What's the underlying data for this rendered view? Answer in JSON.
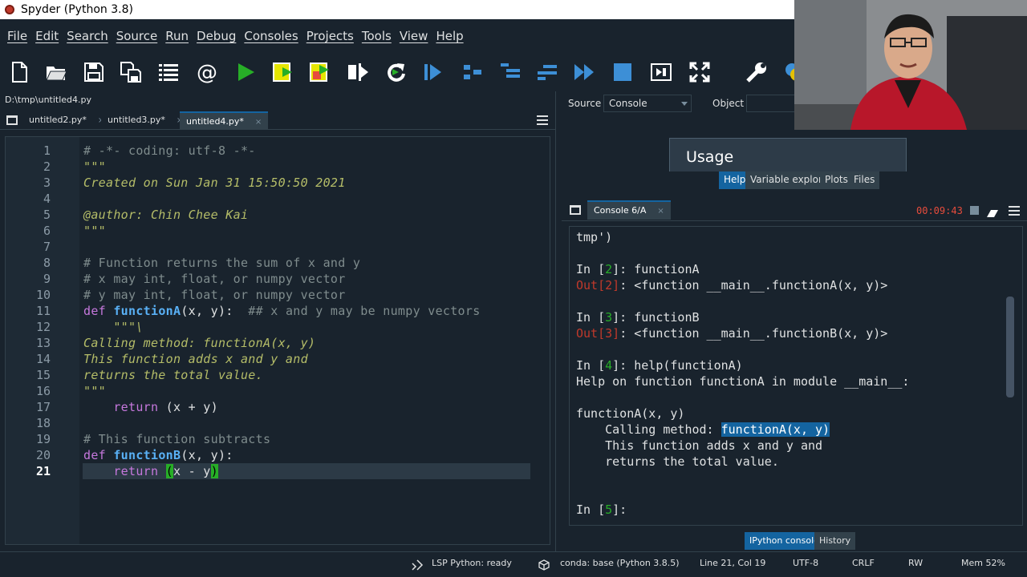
{
  "window": {
    "title": "Spyder (Python 3.8)"
  },
  "menu": [
    "File",
    "Edit",
    "Search",
    "Source",
    "Run",
    "Debug",
    "Consoles",
    "Projects",
    "Tools",
    "View",
    "Help"
  ],
  "toolbar_icons": [
    "new-file",
    "open-file",
    "save",
    "save-all",
    "outline",
    "email-at",
    "run",
    "run-cell",
    "run-cell-advance",
    "run-selection",
    "re-run",
    "debug",
    "debug-step",
    "debug-step-into",
    "debug-step-return",
    "debug-continue",
    "stop",
    "maximize",
    "fullscreen",
    "preferences",
    "python-path"
  ],
  "editor": {
    "path": "D:\\tmp\\untitled4.py",
    "tabs": [
      {
        "label": "untitled2.py*"
      },
      {
        "label": "untitled3.py*"
      },
      {
        "label": "untitled4.py*",
        "active": true
      }
    ],
    "close_glyph": "×",
    "current_line": 21,
    "lines": [
      {
        "n": "1",
        "parts": [
          [
            "cm",
            "# -*- coding: utf-8 -*-"
          ]
        ]
      },
      {
        "n": "2",
        "parts": [
          [
            "str",
            "\"\"\""
          ]
        ]
      },
      {
        "n": "3",
        "parts": [
          [
            "str",
            "Created on Sun Jan 31 15:50:50 2021"
          ]
        ]
      },
      {
        "n": "4",
        "parts": []
      },
      {
        "n": "5",
        "parts": [
          [
            "str",
            "@author: Chin Chee Kai"
          ]
        ]
      },
      {
        "n": "6",
        "parts": [
          [
            "str",
            "\"\"\""
          ]
        ]
      },
      {
        "n": "7",
        "parts": []
      },
      {
        "n": "8",
        "parts": [
          [
            "cm",
            "# Function returns the sum of x and y"
          ]
        ]
      },
      {
        "n": "9",
        "parts": [
          [
            "cm",
            "# x may int, float, or numpy vector"
          ]
        ]
      },
      {
        "n": "10",
        "parts": [
          [
            "cm",
            "# y may int, float, or numpy vector"
          ]
        ]
      },
      {
        "n": "11",
        "parts": [
          [
            "kw",
            "def "
          ],
          [
            "fn",
            "functionA"
          ],
          [
            "",
            "(x, y):  "
          ],
          [
            "cm",
            "## x and y may be numpy vectors"
          ]
        ]
      },
      {
        "n": "12",
        "parts": [
          [
            "str",
            "    \"\"\"\\"
          ]
        ]
      },
      {
        "n": "13",
        "parts": [
          [
            "str",
            "Calling method: functionA(x, y)"
          ]
        ]
      },
      {
        "n": "14",
        "parts": [
          [
            "str",
            "This function adds x and y and"
          ]
        ]
      },
      {
        "n": "15",
        "parts": [
          [
            "str",
            "returns the total value."
          ]
        ]
      },
      {
        "n": "16",
        "parts": [
          [
            "str",
            "\"\"\""
          ]
        ]
      },
      {
        "n": "17",
        "parts": [
          [
            "kw",
            "    return "
          ],
          [
            "",
            "(x + y)"
          ]
        ]
      },
      {
        "n": "18",
        "parts": []
      },
      {
        "n": "19",
        "parts": [
          [
            "cm",
            "# This function subtracts"
          ]
        ]
      },
      {
        "n": "20",
        "parts": [
          [
            "kw",
            "def "
          ],
          [
            "fn",
            "functionB"
          ],
          [
            "",
            "(x, y):"
          ]
        ]
      },
      {
        "n": "21",
        "parts": [
          [
            "kw",
            "    return "
          ],
          [
            "bracket",
            "("
          ],
          [
            "",
            "x - y"
          ],
          [
            "bracket",
            ")"
          ]
        ]
      }
    ]
  },
  "help_pane": {
    "source_label": "Source",
    "source_value": "Console",
    "object_label": "Object",
    "usage_title": "Usage",
    "tabs": [
      "Help",
      "Variable explorer",
      "Plots",
      "Files"
    ],
    "active_tab": "Help"
  },
  "console": {
    "tab_label": "Console 6/A",
    "elapsed": "00:09:43",
    "lines": [
      [
        [
          "",
          "tmp')"
        ]
      ],
      [],
      [
        [
          "",
          "In ["
        ],
        [
          "in",
          "2"
        ],
        [
          "",
          "]: functionA"
        ]
      ],
      [
        [
          "out",
          "Out[2]"
        ],
        [
          "",
          ": <function __main__.functionA(x, y)>"
        ]
      ],
      [],
      [
        [
          "",
          "In ["
        ],
        [
          "in",
          "3"
        ],
        [
          "",
          "]: functionB"
        ]
      ],
      [
        [
          "out",
          "Out[3]"
        ],
        [
          "",
          ": <function __main__.functionB(x, y)>"
        ]
      ],
      [],
      [
        [
          "",
          "In ["
        ],
        [
          "in",
          "4"
        ],
        [
          "",
          "]: help(functionA)"
        ]
      ],
      [
        [
          "",
          "Help on function functionA in module __main__:"
        ]
      ],
      [],
      [
        [
          "",
          "functionA(x, y)"
        ]
      ],
      [
        [
          "",
          "    Calling method: "
        ],
        [
          "hl",
          "functionA(x, y)"
        ]
      ],
      [
        [
          "",
          "    This function adds x and y and"
        ]
      ],
      [
        [
          "",
          "    returns the total value."
        ]
      ],
      [],
      [],
      [
        [
          "",
          "In ["
        ],
        [
          "in",
          "5"
        ],
        [
          "",
          "]:"
        ]
      ]
    ],
    "bottom_tabs": [
      "IPython console",
      "History"
    ],
    "active_bottom_tab": "IPython console"
  },
  "status": {
    "lsp": "LSP Python: ready",
    "conda": "conda: base (Python 3.8.5)",
    "position": "Line 21, Col 19",
    "encoding": "UTF-8",
    "eol": "CRLF",
    "rw": "RW",
    "mem": "Mem 52%"
  },
  "colors": {
    "background": "#19232d",
    "accent": "#1464a0",
    "panel": "#32414b",
    "prompt_green": "#27ae27",
    "out_red": "#c0392b"
  }
}
